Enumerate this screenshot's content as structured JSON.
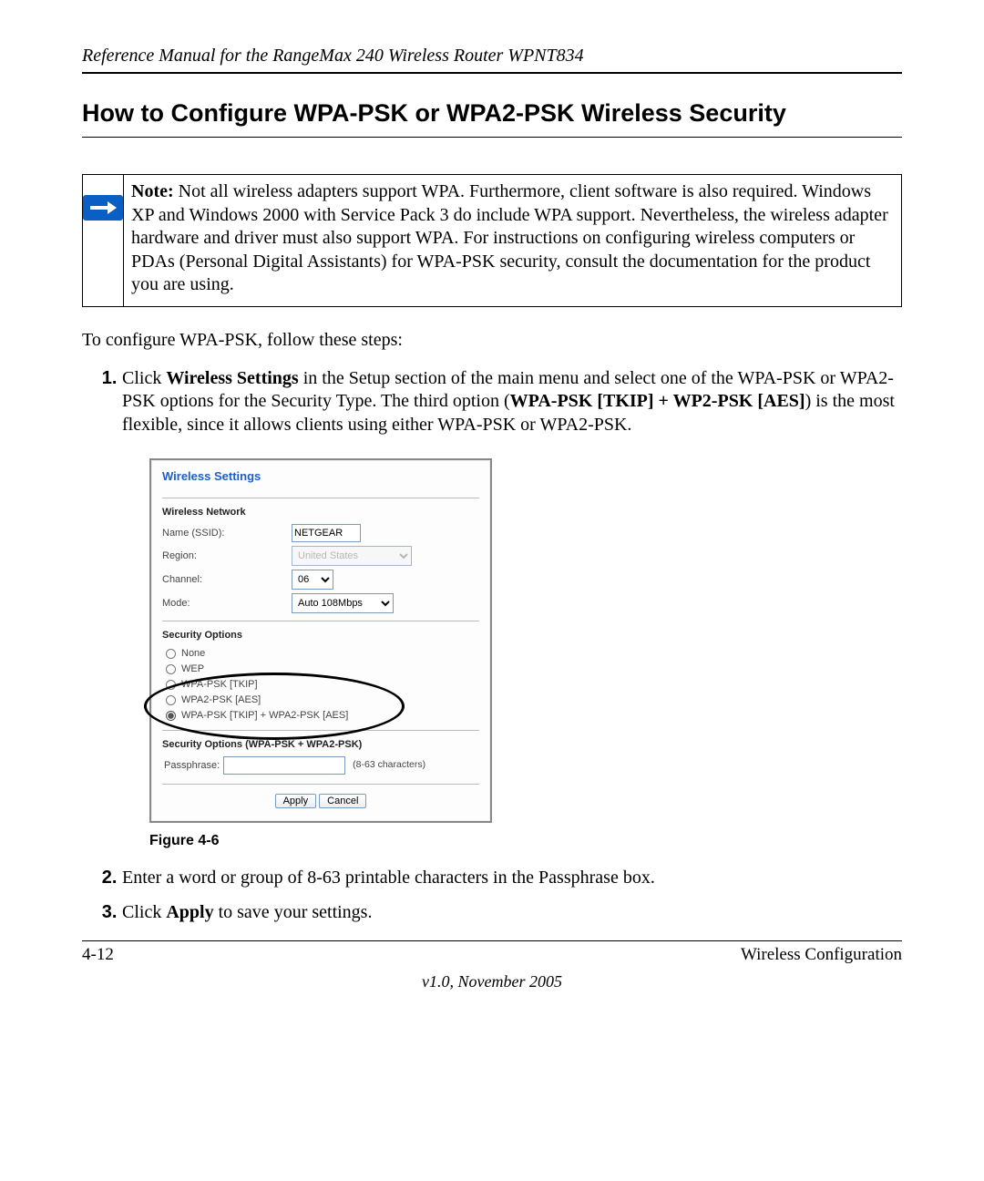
{
  "running_head": "Reference Manual for the RangeMax 240 Wireless Router WPNT834",
  "section_title": "How to Configure WPA-PSK or WPA2-PSK Wireless Security",
  "note": {
    "label": "Note:",
    "text": " Not all wireless adapters support WPA. Furthermore, client software is also required. Windows XP and Windows 2000 with Service Pack 3 do include WPA support. Nevertheless, the wireless adapter hardware and driver must also support WPA. For instructions on configuring wireless computers or PDAs (Personal Digital Assistants) for WPA-PSK security, consult the documentation for the product you are using."
  },
  "intro": "To configure WPA-PSK, follow these steps:",
  "step1": {
    "t1": "Click ",
    "b1": "Wireless Settings",
    "t2": " in the Setup section of the main menu and select one of the WPA-PSK or WPA2-PSK options for the Security Type. The third option (",
    "b2": "WPA-PSK [TKIP] + WP2-PSK [AES]",
    "t3": ") is the most flexible, since it allows clients using either WPA-PSK or WPA2-PSK."
  },
  "panel": {
    "title": "Wireless Settings",
    "net_head": "Wireless Network",
    "ssid_label": "Name (SSID):",
    "ssid_value": "NETGEAR",
    "region_label": "Region:",
    "region_value": "United States",
    "channel_label": "Channel:",
    "channel_value": "06",
    "mode_label": "Mode:",
    "mode_value": "Auto 108Mbps",
    "sec_head": "Security Options",
    "opt_none": "None",
    "opt_wep": "WEP",
    "opt_wpa": "WPA-PSK [TKIP]",
    "opt_wpa2": "WPA2-PSK [AES]",
    "opt_both": "WPA-PSK [TKIP] + WPA2-PSK [AES]",
    "sec2_head": "Security Options (WPA-PSK + WPA2-PSK)",
    "pass_label": "Passphrase:",
    "pass_hint": "(8-63 characters)",
    "apply": "Apply",
    "cancel": "Cancel"
  },
  "figcap": "Figure 4-6",
  "step2": {
    "n": "2.",
    "t": "Enter a word or group of 8-63 printable characters in the Passphrase box."
  },
  "step3": {
    "n": "3.",
    "t1": "Click ",
    "b": "Apply",
    "t2": " to save your settings."
  },
  "footer": {
    "left": "4-12",
    "right": "Wireless Configuration",
    "version": "v1.0, November 2005"
  }
}
